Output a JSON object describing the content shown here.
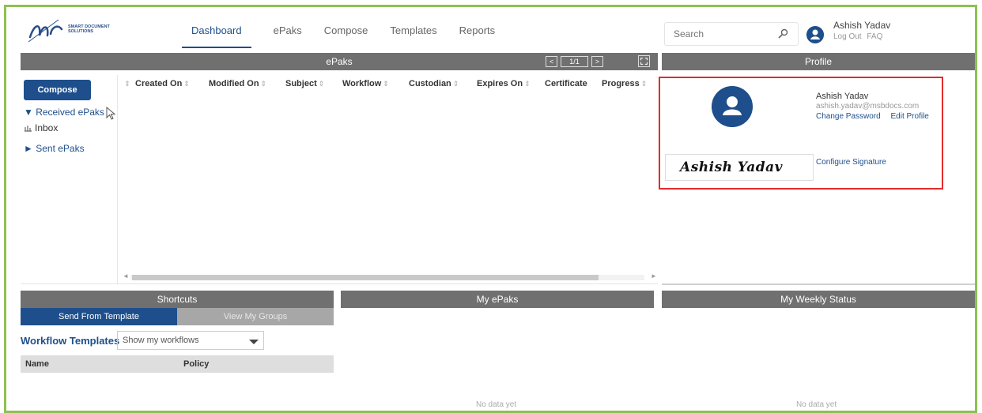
{
  "header": {
    "logo_text": "SMART DOCUMENT SOLUTIONS",
    "nav": [
      "Dashboard",
      "ePaks",
      "Compose",
      "Templates",
      "Reports"
    ],
    "search_placeholder": "Search",
    "user_name": "Ashish Yadav",
    "user_links": [
      "Log Out",
      "FAQ"
    ]
  },
  "epaks_panel": {
    "title": "ePaks",
    "pager": {
      "prev": "<",
      "page": "1/1",
      "next": ">"
    },
    "compose_label": "Compose",
    "tree": [
      "▼ Received ePaks",
      "Inbox",
      "► Sent ePaks"
    ],
    "columns": [
      "Created On",
      "Modified On",
      "Subject",
      "Workflow",
      "Custodian",
      "Expires On",
      "Certificate",
      "Progress"
    ]
  },
  "profile": {
    "title": "Profile",
    "name": "Ashish Yadav",
    "email": "ashish.yadav@msbdocs.com",
    "links": [
      "Change Password",
      "Edit Profile"
    ],
    "signature": "Ashish Yadav",
    "configure_signature": "Configure Signature"
  },
  "shortcuts": {
    "title": "Shortcuts",
    "tabs": [
      "Send From Template",
      "View My Groups"
    ],
    "workflow_label": "Workflow Templates",
    "workflow_select": "Show my workflows",
    "table_columns": [
      "Name",
      "Policy"
    ]
  },
  "my_epaks": {
    "title": "My ePaks",
    "empty": "No data yet"
  },
  "weekly_status": {
    "title": "My Weekly Status",
    "empty": "No data yet"
  },
  "colors": {
    "accent": "#1e4f8c",
    "panel_header": "#707070",
    "frame": "#8cc152",
    "highlight": "#e32b2b"
  }
}
